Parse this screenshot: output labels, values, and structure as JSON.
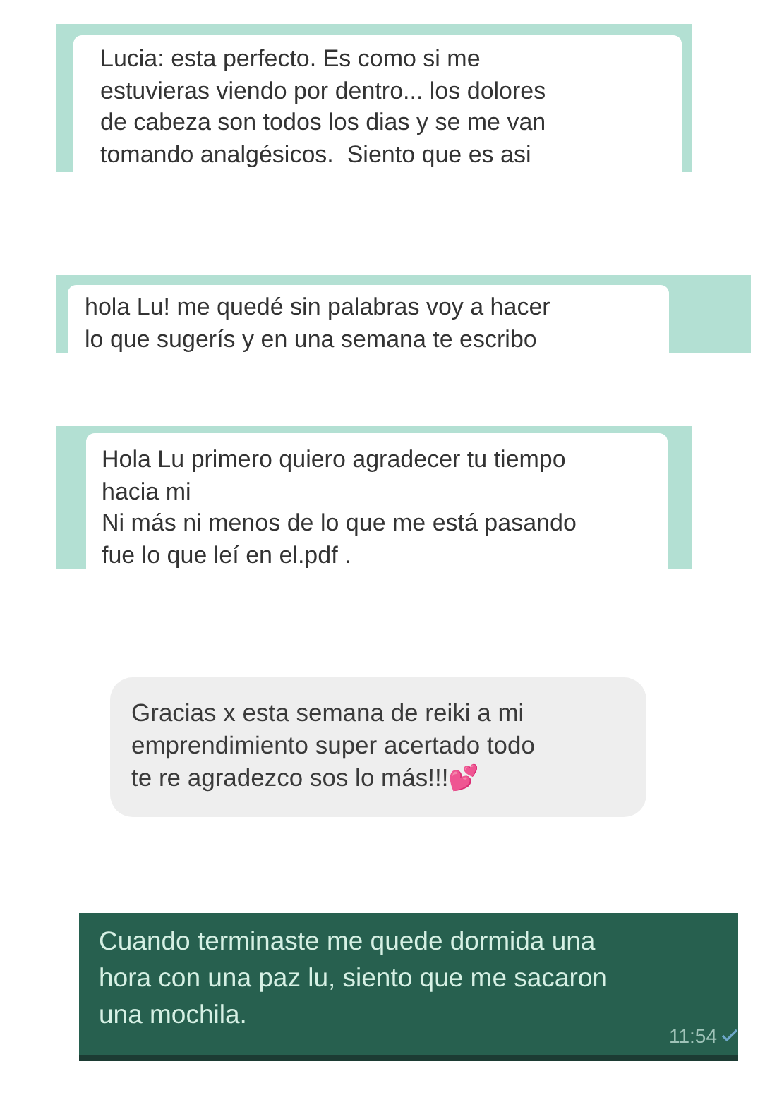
{
  "messages": [
    {
      "kind": "mint-panel",
      "text": "Lucia: esta perfecto. Es como si me\nestuvieras viendo por dentro... los dolores\nde cabeza son todos los dias y se me van\ntomando analgésicos.  Siento que es asi"
    },
    {
      "kind": "mint-panel",
      "text": "hola Lu! me quedé sin palabras voy a hacer\nlo que sugerís y en una semana te escribo"
    },
    {
      "kind": "mint-panel",
      "text": "Hola Lu primero quiero agradecer tu tiempo\nhacia mi\nNi más ni menos de lo que me está pasando\nfue lo que leí en el.pdf ."
    },
    {
      "kind": "grey-bubble",
      "text": "Gracias x esta semana de reiki a mi\nemprendimiento super acertado todo\nte re agradezco sos lo más!!!💕"
    },
    {
      "kind": "dark-bubble",
      "text": "Cuando terminaste me quede dormida una\nhora con una paz lu, siento que me sacaron\nuna mochila.",
      "time": "11:54",
      "read": true
    }
  ]
}
